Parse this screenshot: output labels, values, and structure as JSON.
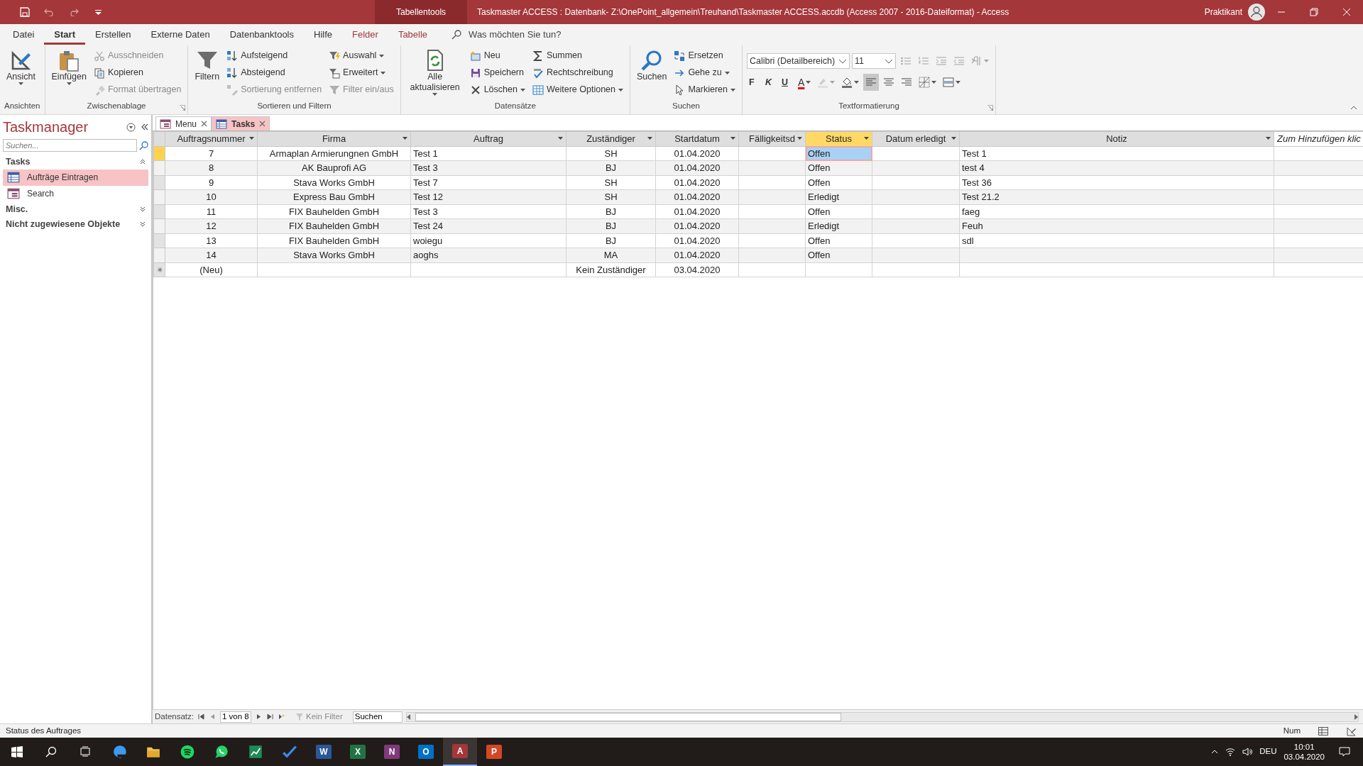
{
  "title_bar": {
    "context_tab": "Tabellentools",
    "title": "Taskmaster ACCESS : Datenbank- Z:\\OnePoint_allgemein\\Treuhand\\Taskmaster ACCESS.accdb (Access 2007 - 2016-Dateiformat)  -  Access",
    "user": "Praktikant"
  },
  "ribbon_tabs": [
    {
      "label": "Datei",
      "selected": false,
      "kind": "normal"
    },
    {
      "label": "Start",
      "selected": true,
      "kind": "normal"
    },
    {
      "label": "Erstellen",
      "selected": false,
      "kind": "normal"
    },
    {
      "label": "Externe Daten",
      "selected": false,
      "kind": "normal"
    },
    {
      "label": "Datenbanktools",
      "selected": false,
      "kind": "normal"
    },
    {
      "label": "Hilfe",
      "selected": false,
      "kind": "normal"
    },
    {
      "label": "Felder",
      "selected": false,
      "kind": "context"
    },
    {
      "label": "Tabelle",
      "selected": false,
      "kind": "context"
    }
  ],
  "tell_me": {
    "placeholder": "Was möchten Sie tun?"
  },
  "ribbon_groups": [
    {
      "label": "Ansichten",
      "columns": [
        [
          {
            "kind": "large",
            "label": "Ansicht",
            "disabled": false,
            "dropdown": true
          }
        ]
      ]
    },
    {
      "label": "Zwischenablage",
      "columns": [
        [
          {
            "kind": "large",
            "label": "Einfügen",
            "disabled": false,
            "dropdown": true
          }
        ],
        [
          {
            "kind": "small",
            "label": "Ausschneiden",
            "disabled": true,
            "dropdown": false
          },
          {
            "kind": "small",
            "label": "Kopieren",
            "disabled": false,
            "dropdown": false
          },
          {
            "kind": "small",
            "label": "Format übertragen",
            "disabled": true,
            "dropdown": false
          }
        ]
      ]
    },
    {
      "label": "Sortieren und Filtern",
      "columns": [
        [
          {
            "kind": "large",
            "label": "Filtern",
            "disabled": false,
            "dropdown": false
          }
        ],
        [
          {
            "kind": "small",
            "label": "Aufsteigend",
            "disabled": false,
            "dropdown": false
          },
          {
            "kind": "small",
            "label": "Absteigend",
            "disabled": false,
            "dropdown": false
          },
          {
            "kind": "small",
            "label": "Sortierung entfernen",
            "disabled": true,
            "dropdown": false
          }
        ],
        [
          {
            "kind": "small",
            "label": "Auswahl",
            "disabled": false,
            "dropdown": true
          },
          {
            "kind": "small",
            "label": "Erweitert",
            "disabled": false,
            "dropdown": true
          },
          {
            "kind": "small",
            "label": "Filter ein/aus",
            "disabled": true,
            "dropdown": false
          }
        ]
      ]
    },
    {
      "label": "Datensätze",
      "columns": [
        [
          {
            "kind": "large",
            "label": "Alle aktualisieren",
            "disabled": false,
            "dropdown": true
          }
        ],
        [
          {
            "kind": "small",
            "label": "Neu",
            "disabled": false,
            "dropdown": false
          },
          {
            "kind": "small",
            "label": "Speichern",
            "disabled": false,
            "dropdown": false
          },
          {
            "kind": "small",
            "label": "Löschen",
            "disabled": false,
            "dropdown": true
          }
        ],
        [
          {
            "kind": "small",
            "label": "Summen",
            "disabled": false,
            "dropdown": false
          },
          {
            "kind": "small",
            "label": "Rechtschreibung",
            "disabled": false,
            "dropdown": false
          },
          {
            "kind": "small",
            "label": "Weitere Optionen",
            "disabled": false,
            "dropdown": true
          }
        ]
      ]
    },
    {
      "label": "Suchen",
      "columns": [
        [
          {
            "kind": "large",
            "label": "Suchen",
            "disabled": false,
            "dropdown": false
          }
        ],
        [
          {
            "kind": "small",
            "label": "Ersetzen",
            "disabled": false,
            "dropdown": false
          },
          {
            "kind": "small",
            "label": "Gehe zu",
            "disabled": false,
            "dropdown": true
          },
          {
            "kind": "small",
            "label": "Markieren",
            "disabled": false,
            "dropdown": true
          }
        ]
      ]
    },
    {
      "label": "Textformatierung",
      "toolbars": [
        {
          "items": [
            {
              "kind": "combo",
              "value": "Calibri (Detailbereich)",
              "disabled": false,
              "dropdown": true
            },
            {
              "kind": "combo",
              "value": "11",
              "disabled": false,
              "dropdown": true
            },
            {
              "kind": "icon",
              "disabled": true,
              "dropdown": false,
              "selected": false
            },
            {
              "kind": "icon",
              "disabled": true,
              "dropdown": false,
              "selected": false
            },
            {
              "kind": "icon",
              "disabled": true,
              "dropdown": false,
              "selected": false
            },
            {
              "kind": "icon",
              "disabled": true,
              "dropdown": false,
              "selected": false
            },
            {
              "kind": "icon",
              "disabled": true,
              "dropdown": true,
              "selected": false
            }
          ]
        },
        {
          "items": [
            {
              "kind": "bold",
              "label": "F",
              "disabled": false,
              "dropdown": false,
              "selected": false
            },
            {
              "kind": "italic",
              "label": "K",
              "disabled": false,
              "dropdown": false,
              "selected": false
            },
            {
              "kind": "underline",
              "label": "U",
              "disabled": false,
              "dropdown": false,
              "selected": false
            },
            {
              "kind": "font-color",
              "label": "A",
              "disabled": false,
              "dropdown": true,
              "selected": false
            },
            {
              "kind": "icon",
              "disabled": true,
              "dropdown": true,
              "selected": false
            },
            {
              "kind": "icon",
              "disabled": false,
              "dropdown": true,
              "selected": false
            },
            {
              "kind": "icon",
              "disabled": false,
              "dropdown": false,
              "selected": true
            },
            {
              "kind": "icon",
              "disabled": false,
              "dropdown": false,
              "selected": false
            },
            {
              "kind": "icon",
              "disabled": false,
              "dropdown": false,
              "selected": false
            },
            {
              "kind": "icon",
              "disabled": false,
              "dropdown": true,
              "selected": false
            },
            {
              "kind": "icon",
              "disabled": false,
              "dropdown": true,
              "selected": false
            }
          ]
        }
      ]
    }
  ],
  "nav_pane": {
    "title": "Taskmanager",
    "search": {
      "placeholder": "Suchen..."
    },
    "groups": [
      {
        "label": "Tasks",
        "expanded": true,
        "items": [
          {
            "label": "Aufträge Eintragen",
            "selected": true
          },
          {
            "label": "Search",
            "selected": false
          }
        ]
      },
      {
        "label": "Misc.",
        "expanded": false
      },
      {
        "label": "Nicht zugewiesene Objekte",
        "expanded": false
      }
    ]
  },
  "document_tabs": [
    {
      "label": "Menu",
      "selected": false
    },
    {
      "label": "Tasks",
      "selected": true
    }
  ],
  "table": {
    "columns": [
      {
        "label": "Auftragsnummer",
        "kind": "field",
        "selected": false
      },
      {
        "label": "Firma",
        "kind": "field",
        "selected": false
      },
      {
        "label": "Auftrag",
        "kind": "field",
        "selected": false
      },
      {
        "label": "Zuständiger",
        "kind": "field",
        "selected": false
      },
      {
        "label": "Startdatum",
        "kind": "field",
        "selected": false
      },
      {
        "label": "Fälligkeitsd",
        "kind": "field",
        "selected": false
      },
      {
        "label": "Status",
        "kind": "field",
        "selected": true
      },
      {
        "label": "Datum erledigt",
        "kind": "field",
        "selected": false
      },
      {
        "label": "Notiz",
        "kind": "field",
        "selected": false
      },
      {
        "label": "Zum Hinzufügen klic",
        "kind": "add",
        "selected": false
      }
    ],
    "rows": [
      {
        "kind": "record",
        "current": true,
        "cells": [
          "7",
          "Armaplan Armierungnen GmbH",
          "Test 1",
          "SH",
          "01.04.2020",
          "",
          "Offen",
          "",
          "Test 1",
          ""
        ]
      },
      {
        "kind": "record",
        "current": false,
        "cells": [
          "8",
          "AK Bauprofi AG",
          "Test 3",
          "BJ",
          "01.04.2020",
          "",
          "Offen",
          "",
          "test 4",
          ""
        ]
      },
      {
        "kind": "record",
        "current": false,
        "cells": [
          "9",
          "Stava Works GmbH",
          "Test 7",
          "SH",
          "01.04.2020",
          "",
          "Offen",
          "",
          "Test 36",
          ""
        ]
      },
      {
        "kind": "record",
        "current": false,
        "cells": [
          "10",
          "Express Bau GmbH",
          "Test 12",
          "SH",
          "01.04.2020",
          "",
          "Erledigt",
          "",
          "Test 21.2",
          ""
        ]
      },
      {
        "kind": "record",
        "current": false,
        "cells": [
          "11",
          "FIX Bauhelden GmbH",
          "Test 3",
          "BJ",
          "01.04.2020",
          "",
          "Offen",
          "",
          "faeg",
          ""
        ]
      },
      {
        "kind": "record",
        "current": false,
        "cells": [
          "12",
          "FIX Bauhelden GmbH",
          "Test 24",
          "BJ",
          "01.04.2020",
          "",
          "Erledigt",
          "",
          "Feuh",
          ""
        ]
      },
      {
        "kind": "record",
        "current": false,
        "cells": [
          "13",
          "FIX Bauhelden GmbH",
          "woiegu",
          "BJ",
          "01.04.2020",
          "",
          "Offen",
          "",
          "sdl",
          ""
        ]
      },
      {
        "kind": "record",
        "current": false,
        "cells": [
          "14",
          "Stava Works GmbH",
          "aoghs",
          "MA",
          "01.04.2020",
          "",
          "Offen",
          "",
          "",
          ""
        ]
      },
      {
        "kind": "new",
        "current": false,
        "marker": "✳",
        "cells": [
          "(Neu)",
          "",
          "",
          "Kein Zuständiger",
          "03.04.2020",
          "",
          "",
          "",
          "",
          ""
        ]
      }
    ]
  },
  "record_nav": {
    "label": "Datensatz:",
    "position": "1 von 8",
    "filter": {
      "label": "Kein Filter",
      "disabled": true
    },
    "search": "Suchen"
  },
  "status_bar": {
    "text": "Status des Auftrages",
    "indicator": "Num"
  },
  "taskbar": {
    "apps": [
      {
        "kind": "glyph",
        "active": false
      },
      {
        "kind": "glyph",
        "active": false
      },
      {
        "kind": "glyph",
        "active": false
      },
      {
        "kind": "glyph",
        "active": false
      },
      {
        "kind": "glyph",
        "active": false
      },
      {
        "kind": "glyph",
        "active": false
      },
      {
        "kind": "letter",
        "letter": "W",
        "color": "#2b579a",
        "active": false
      },
      {
        "kind": "letter",
        "letter": "X",
        "color": "#217346",
        "active": false
      },
      {
        "kind": "letter",
        "letter": "N",
        "color": "#80397b",
        "active": false
      },
      {
        "kind": "letter",
        "letter": "O",
        "color": "#0072c6",
        "active": false
      },
      {
        "kind": "letter",
        "letter": "A",
        "color": "#a4373a",
        "active": true
      },
      {
        "kind": "letter",
        "letter": "P",
        "color": "#d24726",
        "active": false
      }
    ],
    "language": "DEU",
    "time": "10:01",
    "date": "03.04.2020"
  }
}
